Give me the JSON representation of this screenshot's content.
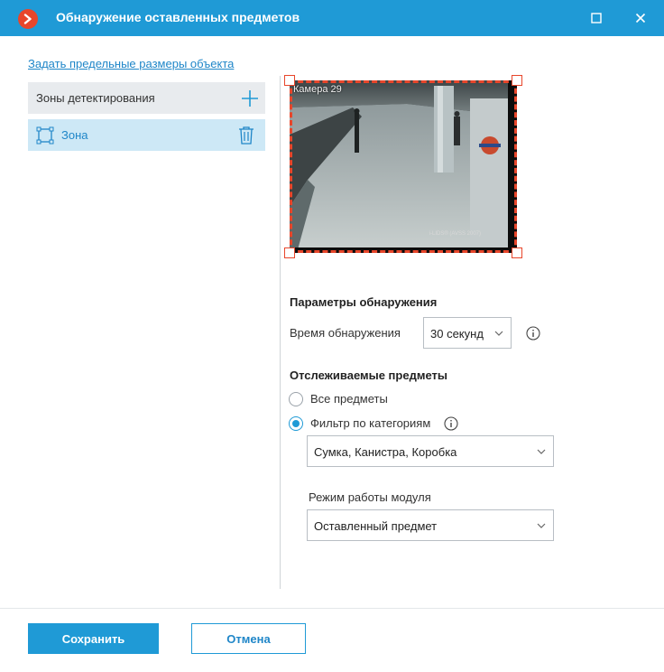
{
  "window": {
    "title": "Обнаружение оставленных предметов"
  },
  "link_set_size": "Задать предельные размеры объекта",
  "zones": {
    "header": "Зоны детектирования",
    "items": [
      {
        "label": "Зона"
      }
    ]
  },
  "preview": {
    "camera_label": "Камера 29",
    "watermark": "i-LIDS® (AVSS 2007)"
  },
  "detection": {
    "section_title": "Параметры обнаружения",
    "time_label": "Время обнаружения",
    "time_value": "30 секунд"
  },
  "tracked": {
    "section_title": "Отслеживаемые предметы",
    "option_all": "Все предметы",
    "option_filter": "Фильтр по категориям",
    "selected_option": "filter",
    "categories_value": "Сумка, Канистра, Коробка",
    "mode_label": "Режим работы модуля",
    "mode_value": "Оставленный предмет"
  },
  "footer": {
    "save_label": "Сохранить",
    "cancel_label": "Отмена"
  },
  "colors": {
    "accent": "#1f9ad6",
    "zone_outline": "#e8462b",
    "zone_selected_bg": "#cde8f6"
  }
}
